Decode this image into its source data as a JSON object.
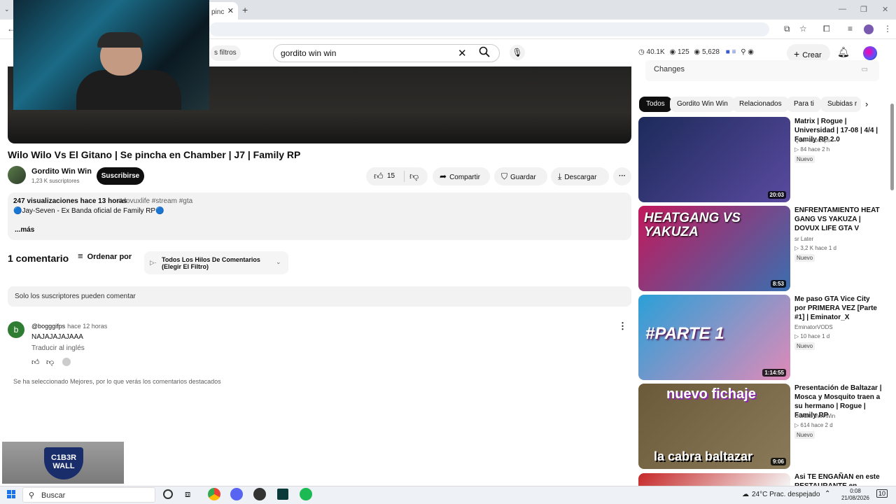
{
  "browser": {
    "tab_title": "pinc",
    "new_tab": "+",
    "close_tab": "✕"
  },
  "youtube_header": {
    "filters_label": "s filtros",
    "search_value": "gordito win win",
    "stats": {
      "views": "40.1K",
      "viewers": "125",
      "watchers": "5,628"
    },
    "create_label": "Crear"
  },
  "video": {
    "title": "Wilo Wilo Vs El Gitano | Se pincha en Chamber | J7 | Family RP",
    "channel_name": "Gordito Win Win",
    "subscribers": "1,23 K suscriptores",
    "subscribe_label": "Suscribirse",
    "likes": "15",
    "share_label": "Compartir",
    "save_label": "Guardar",
    "download_label": "Descargar",
    "more_label": "···"
  },
  "description": {
    "views_time": "247 visualizaciones  hace 13 horas",
    "tags": "#dovuxlife #stream #gta",
    "line1": "🔵Jay-Seven - Ex Banda oficial de Family RP🔵",
    "more": "...más"
  },
  "comments": {
    "count_label": "1 comentario",
    "sort_label": "Ordenar por",
    "filter_label": "Todos Los Hilos De Comentarios (Elegir El Filtro)",
    "only_subs": "Solo los suscriptores pueden comentar",
    "items": [
      {
        "initial": "b",
        "author": "@bogggifps",
        "time": "hace 12 horas",
        "text": "NAJAJAJAJAAA",
        "translate": "Traducir al inglés"
      }
    ],
    "note": "Se ha seleccionado Mejores, por lo que verás los comentarios destacados"
  },
  "overlay": {
    "logo_text": "C1B3R WALL"
  },
  "sidebar": {
    "changes_label": "Changes",
    "chips": [
      "Todos",
      "Gordito Win Win",
      "Relacionados",
      "Para ti",
      "Subidas r"
    ],
    "videos": [
      {
        "title": "Matrix | Rogue | Universidad | 17-08 | 4/4 | Family RP 2.0",
        "channel": "QuePasoClips",
        "meta": "▷ 84   hace 2 h",
        "badge": "Nuevo",
        "duration": "20:03",
        "thumb_colors": [
          "#1c2a5a",
          "#5a4aa0"
        ]
      },
      {
        "title": "ENFRENTAMIENTO HEAT GANG VS YAKUZA  | DOVUX LIFE GTA V",
        "channel": "sr Later",
        "meta": "▷ 3,2 K   hace 1 d",
        "badge": "Nuevo",
        "duration": "8:53",
        "thumb_text": "HEATGANG VS YAKUZA",
        "thumb_colors": [
          "#c2185b",
          "#3a6fb0"
        ]
      },
      {
        "title": "Me paso GTA Vice City por PRIMERA VEZ [Parte #1] | Eminator_X",
        "channel": "EminatorVODS",
        "meta": "▷ 10   hace 1 d",
        "badge": "Nuevo",
        "duration": "1:14:55",
        "thumb_text": "#PARTE 1",
        "thumb_colors": [
          "#2aa0d8",
          "#e08ab8"
        ]
      },
      {
        "title": "Presentación de Baltazar | Mosca y Mosquito traen a su hermano | Rogue | Family RP",
        "channel": "Gordito Win Win",
        "meta": "▷ 614   hace 2 d",
        "badge": "Nuevo",
        "duration": "9:06",
        "thumb_text": "nuevo fichaje",
        "thumb_text2": "la cabra baltazar",
        "thumb_colors": [
          "#6a5a3a",
          "#8a7a5a"
        ]
      },
      {
        "title": "Asi TE ENGAÑAN en este RESTAURANTE en ALBACETE",
        "channel": "",
        "meta": "",
        "badge": "",
        "duration": "",
        "thumb_colors": [
          "#c62828",
          "#f5f5f5"
        ]
      }
    ]
  },
  "taskbar": {
    "search_placeholder": "Buscar",
    "weather": "24°C  Prac. despejado",
    "time": "0:08",
    "date": "21/08/2026",
    "notifications": "10"
  }
}
